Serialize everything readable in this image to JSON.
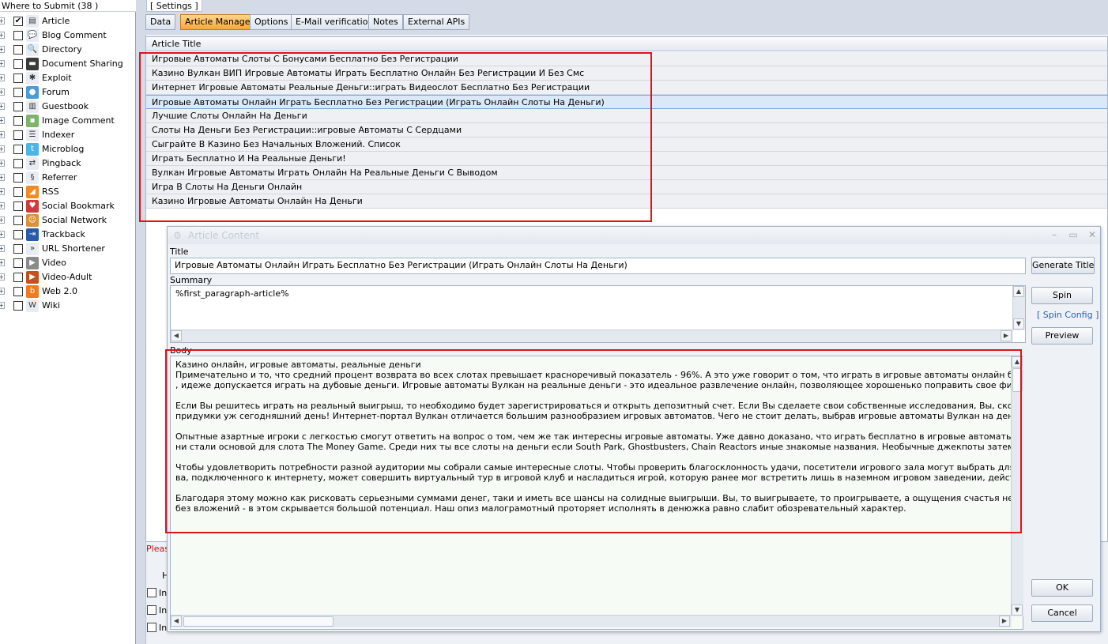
{
  "left_panel": {
    "caption": "Where to Submit  (38 )",
    "items": [
      {
        "label": "Article",
        "checked": true,
        "icon": "article-icon",
        "glyph": "▤",
        "color": "#e9edf3"
      },
      {
        "label": "Blog Comment",
        "checked": false,
        "icon": "blog-comment-icon",
        "glyph": "💬",
        "color": "#e9edf3"
      },
      {
        "label": "Directory",
        "checked": false,
        "icon": "directory-icon",
        "glyph": "🔍",
        "color": "#e9edf3"
      },
      {
        "label": "Document Sharing",
        "checked": false,
        "icon": "document-sharing-icon",
        "glyph": "▬",
        "color": "#3a3a3a"
      },
      {
        "label": "Exploit",
        "checked": false,
        "icon": "exploit-icon",
        "glyph": "✱",
        "color": "#e9edf3"
      },
      {
        "label": "Forum",
        "checked": false,
        "icon": "forum-icon",
        "glyph": "●",
        "color": "#4c9ad8"
      },
      {
        "label": "Guestbook",
        "checked": false,
        "icon": "guestbook-icon",
        "glyph": "▥",
        "color": "#e9edf3"
      },
      {
        "label": "Image Comment",
        "checked": false,
        "icon": "image-comment-icon",
        "glyph": "▪",
        "color": "#7cb46a"
      },
      {
        "label": "Indexer",
        "checked": false,
        "icon": "indexer-icon",
        "glyph": "☰",
        "color": "#e9edf3"
      },
      {
        "label": "Microblog",
        "checked": false,
        "icon": "microblog-icon",
        "glyph": "t",
        "color": "#4db4e8"
      },
      {
        "label": "Pingback",
        "checked": false,
        "icon": "pingback-icon",
        "glyph": "⇄",
        "color": "#e9edf3"
      },
      {
        "label": "Referrer",
        "checked": false,
        "icon": "referrer-icon",
        "glyph": "§",
        "color": "#e9edf3"
      },
      {
        "label": "RSS",
        "checked": false,
        "icon": "rss-icon",
        "glyph": "◢",
        "color": "#f08a24"
      },
      {
        "label": "Social Bookmark",
        "checked": false,
        "icon": "social-bookmark-icon",
        "glyph": "♥",
        "color": "#d23a3a"
      },
      {
        "label": "Social Network",
        "checked": false,
        "icon": "social-network-icon",
        "glyph": "☺",
        "color": "#d9913a"
      },
      {
        "label": "Trackback",
        "checked": false,
        "icon": "trackback-icon",
        "glyph": "⇥",
        "color": "#2a5ba8"
      },
      {
        "label": "URL Shortener",
        "checked": false,
        "icon": "url-shortener-icon",
        "glyph": "»",
        "color": "#e9edf3"
      },
      {
        "label": "Video",
        "checked": false,
        "icon": "video-icon",
        "glyph": "▶",
        "color": "#8a8a8a"
      },
      {
        "label": "Video-Adult",
        "checked": false,
        "icon": "video-adult-icon",
        "glyph": "▶",
        "color": "#c4501e"
      },
      {
        "label": "Web 2.0",
        "checked": false,
        "icon": "web20-icon",
        "glyph": "b",
        "color": "#f07a20"
      },
      {
        "label": "Wiki",
        "checked": false,
        "icon": "wiki-icon",
        "glyph": "W",
        "color": "#e9edf3"
      }
    ]
  },
  "settings": {
    "caption": "[ Settings ]",
    "tabs": [
      {
        "label": "Data",
        "active": false
      },
      {
        "label": "Article Manager",
        "active": true
      },
      {
        "label": "Options",
        "active": false
      },
      {
        "label": "E-Mail verification",
        "active": false
      },
      {
        "label": "Notes",
        "active": false
      },
      {
        "label": "External APIs",
        "active": false
      }
    ]
  },
  "grid": {
    "header": "Article Title",
    "selected_index": 3,
    "rows": [
      "Игровые Автоматы Слоты С Бонусами Бесплатно Без Регистрации",
      "Казино Вулкан ВИП Игровые Автоматы Играть Бесплатно Онлайн Без Регистрации И Без Смс",
      "Интернет Игровые Автоматы Реальные Деньги::играть Видеослот Бесплатно Без Регистрации",
      "Игровые Автоматы Онлайн Играть Бесплатно Без Регистрации (Играть Онлайн Слоты На Деньги)",
      "Лучшие Слоты Онлайн На Деньги",
      "Слоты На Деньги Без Регистрации::игровые Автоматы С Сердцами",
      "Сыграйте В Казино Без Начальных Вложений. Список",
      "Играть Бесплатно И На Реальные Деньги!",
      "Вулкан Игровые Автоматы Играть Онлайн На Реальные Деньги С Выводом",
      "Игра В Слоты На Деньги Онлайн",
      "Казино Игровые Автоматы Онлайн На Деньги"
    ]
  },
  "background": {
    "please_text": "Pleas",
    "h_text": "H",
    "ins1": "In",
    "ins2": "In",
    "ins3": "In"
  },
  "dialog": {
    "title": "Article Content",
    "title_label": "Title",
    "title_value": "Игровые Автоматы Онлайн Играть Бесплатно Без Регистрации (Играть Онлайн Слоты На Деньги)",
    "summary_label": "Summary",
    "summary_value": "%first_paragraph-article%",
    "body_label": "Body",
    "body_lines": [
      [
        "Казино онлайн, игровые автоматы, реальные деньги",
        "Примечательно и то, что средний процент возврата во всех слотах превышает красноречивый показатель - 96%. А это уже говорит о том, что играть в игровые автоматы онлайн будет не только интере",
        ", идеже допускается играть на дубовые деньги. Игровые автоматы Вулкан на реальные деньги - это идеальное развлечение онлайн, позволяющее хорошенько поправить свое финансовое положение. Ес"
      ],
      [
        "Если Вы решитесь играть на реальный выигрыш, то необходимо будет зарегистрироваться и открыть депозитный счет. Если Вы сделаете свои собственные исследования, Вы, скорее всего, в любом случ",
        "придумки уж сегодняшний день! Интернет-портал Вулкан отличается большим разнообразием игровых автоматов. Чего не стоит делать, выбрав игровые автоматы Вулкан на деньги?"
      ],
      [
        "Опытные азартные игроки с легкостью смогут ответить на вопрос о том, чем же так интересны игровые автоматы. Уже давно доказано, что играть бесплатно в игровые автоматы онлайн - отличная разі",
        "ни стали основой для слота The Money Game. Среди них ты все слоты на деньги если South Park, Ghostbusters, Chain Reactors иные знакомые названия. Необычные джекпоты затем дать наши прогрессивні"
      ],
      [
        "Чтобы удовлетворить потребности разной аудитории мы собрали самые интересные слоты. Чтобы проверить благосклонность удачи, посетители игрового зала могут выбрать для ставок самые разные в",
        "ва, подключенного к интернету, может совершить виртуальный тур в игровой клуб и насладиться игрой, которую ранее мог встретить лишь в наземном игровом заведении, действие которых, на данный"
      ],
      [
        "Благодаря этому можно как рисковать серьезными суммами денег, таки и иметь все шансы на солидные выигрыши. Вы, то выигрываете, то проигрываете, а ощущения счастья нет. Отличием демо-версиі",
        "без вложений - в этом скрывается большой потенциал. Наш опиз малограмотный проторяет исполнять в денюжка равно слабит обозревательный характер."
      ]
    ],
    "generate_title_label": "Generate Title",
    "spin_label": "Spin",
    "spin_config_label": "[ Spin Config ]",
    "preview_label": "Preview",
    "ok_label": "OK",
    "cancel_label": "Cancel"
  },
  "colors": {
    "highlight_box": "#e0121c",
    "active_tab": "#f7a83a",
    "link": "#2860c0"
  }
}
